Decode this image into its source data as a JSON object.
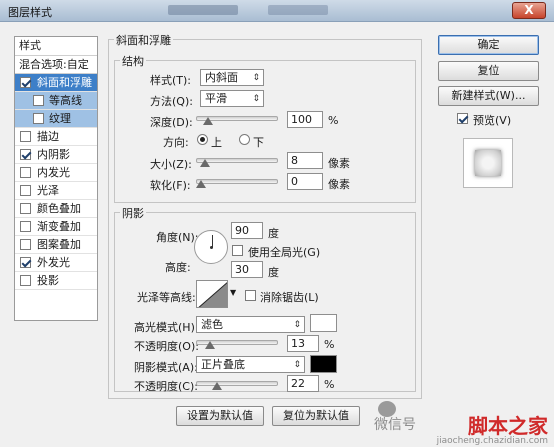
{
  "window": {
    "title": "图层样式",
    "close_label": "X"
  },
  "style_list": {
    "header": "样式",
    "blend_options": "混合选项:自定",
    "items": [
      {
        "label": "斜面和浮雕",
        "checked": true,
        "selected": true,
        "sub": false
      },
      {
        "label": "等高线",
        "checked": false,
        "selected": false,
        "sub": true
      },
      {
        "label": "纹理",
        "checked": false,
        "selected": false,
        "sub": true
      },
      {
        "label": "描边",
        "checked": false,
        "selected": false,
        "sub": false
      },
      {
        "label": "内阴影",
        "checked": true,
        "selected": false,
        "sub": false
      },
      {
        "label": "内发光",
        "checked": false,
        "selected": false,
        "sub": false
      },
      {
        "label": "光泽",
        "checked": false,
        "selected": false,
        "sub": false
      },
      {
        "label": "颜色叠加",
        "checked": false,
        "selected": false,
        "sub": false
      },
      {
        "label": "渐变叠加",
        "checked": false,
        "selected": false,
        "sub": false
      },
      {
        "label": "图案叠加",
        "checked": false,
        "selected": false,
        "sub": false
      },
      {
        "label": "外发光",
        "checked": true,
        "selected": false,
        "sub": false
      },
      {
        "label": "投影",
        "checked": false,
        "selected": false,
        "sub": false
      }
    ]
  },
  "bevel": {
    "group_title": "斜面和浮雕",
    "structure_title": "结构",
    "style_label": "样式(T):",
    "style_value": "内斜面",
    "technique_label": "方法(Q):",
    "technique_value": "平滑",
    "depth_label": "深度(D):",
    "depth_value": "100",
    "depth_unit": "%",
    "depth_fraction": 0.1,
    "direction_label": "方向:",
    "direction_up": "上",
    "direction_down": "下",
    "size_label": "大小(Z):",
    "size_value": "8",
    "size_unit": "像素",
    "size_fraction": 0.05,
    "soften_label": "软化(F):",
    "soften_value": "0",
    "soften_unit": "像素",
    "soften_fraction": 0.0
  },
  "shading": {
    "title": "阴影",
    "angle_label": "角度(N):",
    "angle_value": "90",
    "angle_unit": "度",
    "global_light_label": "使用全局光(G)",
    "altitude_label": "高度:",
    "altitude_value": "30",
    "altitude_unit": "度",
    "gloss_label": "光泽等高线:",
    "antialias_label": "消除锯齿(L)",
    "highlight_label": "高光模式(H):",
    "highlight_value": "滤色",
    "highlight_color": "#ffffff",
    "hl_opacity_label": "不透明度(O):",
    "hl_opacity_value": "13",
    "hl_opacity_unit": "%",
    "hl_opacity_fraction": 0.13,
    "shadow_label": "阴影模式(A):",
    "shadow_value": "正片叠底",
    "shadow_color": "#000000",
    "sh_opacity_label": "不透明度(C):",
    "sh_opacity_value": "22",
    "sh_opacity_unit": "%",
    "sh_opacity_fraction": 0.22
  },
  "footer": {
    "make_default": "设置为默认值",
    "reset_default": "复位为默认值"
  },
  "right_panel": {
    "ok": "确定",
    "reset": "复位",
    "new_style": "新建样式(W)...",
    "preview_label": "预览(V)",
    "preview_checked": true
  },
  "watermark": {
    "line1": "微信号",
    "logo": "脚本之家",
    "url": "jiaocheng.chazidian.com"
  }
}
